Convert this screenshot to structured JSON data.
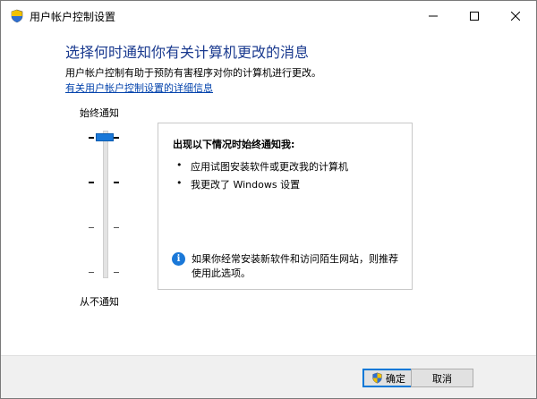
{
  "window": {
    "title": "用户帐户控制设置",
    "min_glyph": "─",
    "max_glyph": "☐",
    "close_glyph": "✕"
  },
  "content": {
    "heading": "选择何时通知你有关计算机更改的消息",
    "description": "用户帐户控制有助于预防有害程序对你的计算机进行更改。",
    "link": "有关用户帐户控制设置的详细信息"
  },
  "slider": {
    "top_label": "始终通知",
    "bottom_label": "从不通知",
    "level_index": 0,
    "level_count": 4
  },
  "panel": {
    "title": "出现以下情况时始终通知我:",
    "bullets": [
      "应用试图安装软件或更改我的计算机",
      "我更改了 Windows 设置"
    ],
    "info_glyph": "i",
    "info_text": "如果你经常安装新软件和访问陌生网站，则推荐使用此选项。"
  },
  "buttons": {
    "ok": "确定",
    "cancel": "取消"
  },
  "colors": {
    "heading": "#1a3a8f",
    "accent": "#1a78d8",
    "link": "#0645ad"
  },
  "icons": {
    "app": "uac-shield-icon",
    "ok": "uac-shield-icon",
    "info": "info-icon"
  }
}
